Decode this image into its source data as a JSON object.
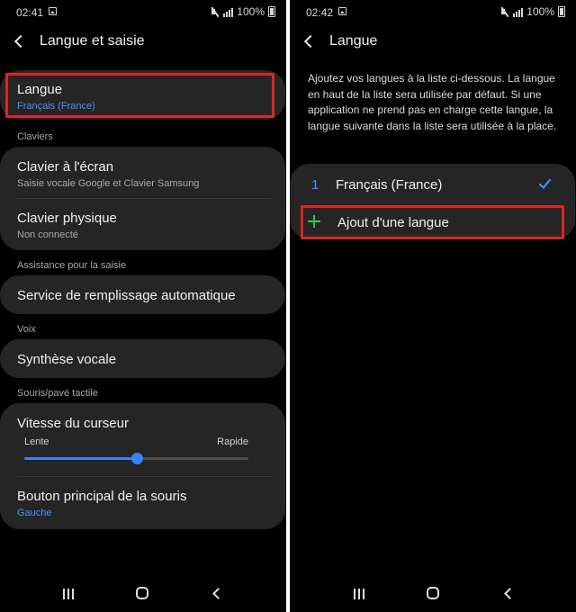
{
  "left": {
    "status": {
      "time": "02:41",
      "battery": "100%"
    },
    "header": {
      "title": "Langue et saisie"
    },
    "langue": {
      "label": "Langue",
      "value": "Français (France)"
    },
    "claviers": {
      "section": "Claviers",
      "on_screen": {
        "label": "Clavier à l'écran",
        "value": "Saisie vocale Google et Clavier Samsung"
      },
      "physical": {
        "label": "Clavier physique",
        "value": "Non connecté"
      }
    },
    "assistance": {
      "section": "Assistance pour la saisie",
      "autofill": {
        "label": "Service de remplissage automatique"
      }
    },
    "voix": {
      "section": "Voix",
      "tts": {
        "label": "Synthèse vocale"
      }
    },
    "souris": {
      "section": "Souris/pavé tactile",
      "speed": {
        "label": "Vitesse du curseur",
        "min_label": "Lente",
        "max_label": "Rapide",
        "level": 0.5
      },
      "primary_button": {
        "label": "Bouton principal de la souris",
        "value": "Gauche"
      }
    }
  },
  "right": {
    "status": {
      "time": "02:42",
      "battery": "100%"
    },
    "header": {
      "title": "Langue"
    },
    "description": "Ajoutez vos langues à la liste ci-dessous. La langue en haut de la liste sera utilisée par défaut. Si une application ne prend pas en charge cette langue, la langue suivante dans la liste sera utilisée à la place.",
    "languages": [
      {
        "index": "1",
        "name": "Français (France)"
      }
    ],
    "add_label": "Ajout d'une langue"
  },
  "colors": {
    "accent": "#4a90ff",
    "highlight": "#d9262b",
    "add": "#3fc24f",
    "card": "#252525"
  },
  "icons": [
    "image-icon",
    "mute-icon",
    "signal-icon",
    "battery-icon",
    "back-arrow-icon",
    "check-icon",
    "plus-icon",
    "recents-icon",
    "home-icon",
    "nav-back-icon"
  ]
}
